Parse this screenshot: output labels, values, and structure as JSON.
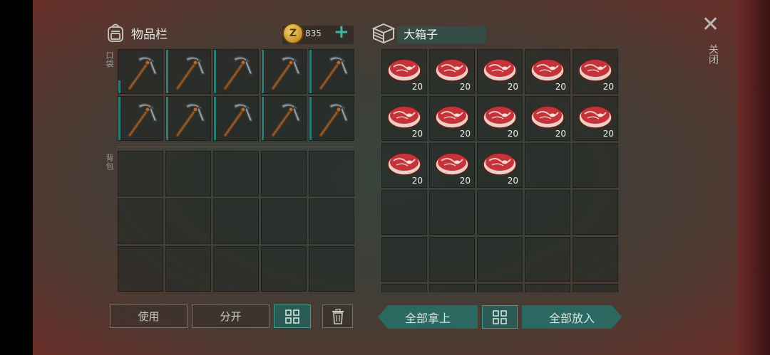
{
  "inventory": {
    "title": "物品栏",
    "coins": "835",
    "coin_symbol": "Z",
    "add_label": "+",
    "pocket_label": "口袋",
    "backpack_label": "背包",
    "pocket_items": [
      {
        "item": "pickaxe",
        "bar": "short"
      },
      {
        "item": "pickaxe",
        "bar": "full"
      },
      {
        "item": "pickaxe",
        "bar": "full"
      },
      {
        "item": "pickaxe",
        "bar": "full"
      },
      {
        "item": "pickaxe",
        "bar": "full"
      },
      {
        "item": "pickaxe",
        "bar": "full"
      },
      {
        "item": "pickaxe",
        "bar": "full"
      },
      {
        "item": "pickaxe",
        "bar": "full"
      },
      {
        "item": "pickaxe",
        "bar": "full"
      },
      {
        "item": "pickaxe",
        "bar": "full"
      }
    ],
    "backpack_slots": 15,
    "use_label": "使用",
    "split_label": "分开"
  },
  "chest": {
    "title": "大箱子",
    "items": [
      {
        "item": "steak",
        "qty": "20"
      },
      {
        "item": "steak",
        "qty": "20"
      },
      {
        "item": "steak",
        "qty": "20"
      },
      {
        "item": "steak",
        "qty": "20"
      },
      {
        "item": "steak",
        "qty": "20"
      },
      {
        "item": "steak",
        "qty": "20"
      },
      {
        "item": "steak",
        "qty": "20"
      },
      {
        "item": "steak",
        "qty": "20"
      },
      {
        "item": "steak",
        "qty": "20"
      },
      {
        "item": "steak",
        "qty": "20"
      },
      {
        "item": "steak",
        "qty": "20"
      },
      {
        "item": "steak",
        "qty": "20"
      },
      {
        "item": "steak",
        "qty": "20"
      }
    ],
    "total_slots": 30,
    "take_all_label": "全部拿上",
    "put_all_label": "全部放入"
  },
  "close_label": "关闭",
  "close_icon": "✕",
  "colors": {
    "accent": "#2b7b76",
    "coin": "#d9a43a",
    "plus": "#3fb8a0"
  }
}
